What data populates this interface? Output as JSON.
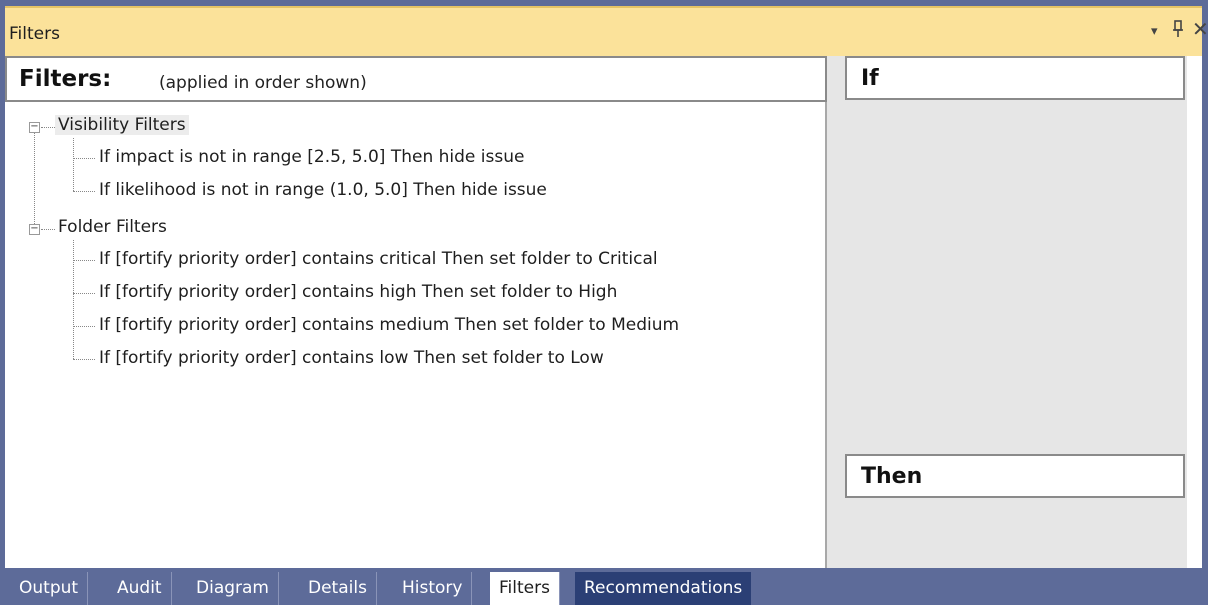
{
  "window": {
    "title": "Filters",
    "buttons": {
      "dropdown_icon": "▾",
      "pin_icon": "ᴘ",
      "close_icon": "✕"
    }
  },
  "filters": {
    "heading": "Filters:",
    "subheading": "(applied in order shown)",
    "groups": [
      {
        "label": "Visibility Filters",
        "items": [
          "If impact is not in range [2.5, 5.0] Then hide issue",
          "If likelihood is not in range (1.0, 5.0] Then hide issue"
        ]
      },
      {
        "label": "Folder Filters",
        "items": [
          "If [fortify priority order] contains critical Then set folder to Critical",
          "If [fortify priority order] contains high Then set folder to High",
          "If [fortify priority order] contains medium Then set folder to Medium",
          "If [fortify priority order] contains low Then set folder to Low"
        ]
      }
    ]
  },
  "right": {
    "if_label": "If",
    "then_label": "Then"
  },
  "tabs": [
    {
      "label": "Output"
    },
    {
      "label": "Audit"
    },
    {
      "label": "Diagram"
    },
    {
      "label": "Details"
    },
    {
      "label": "History"
    },
    {
      "label": "Filters",
      "active": true
    },
    {
      "label": "Recommendations"
    }
  ],
  "colors": {
    "frame": "#5d6b99",
    "titlebar": "#fbe29a",
    "recommendations_tab": "#2b3f75"
  }
}
